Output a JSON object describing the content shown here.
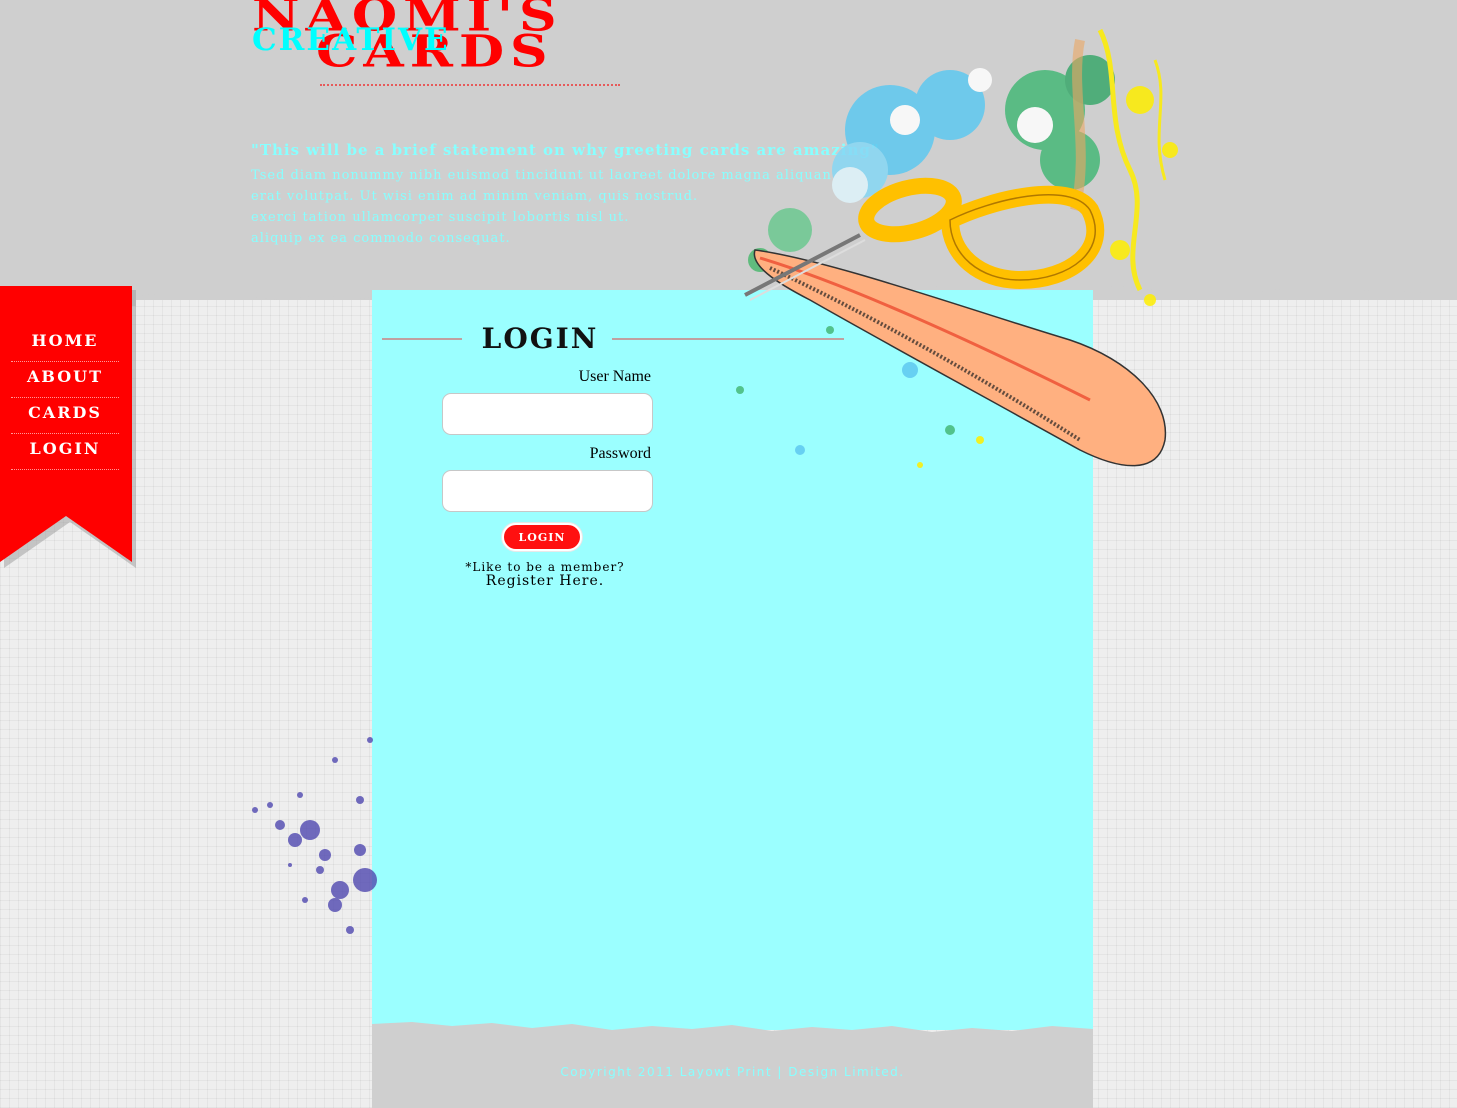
{
  "brand": {
    "line1": "NAOMI'S",
    "line2": "CARDS",
    "overlay": "CREATIVE",
    "primary_color": "#ff0000",
    "accent_color": "#00ffff"
  },
  "header": {
    "statement": "\"This will be a brief statement on why greeting cards are amazing\"",
    "lorem_lines": [
      "Tsed diam nonummy nibh euismod tincidunt ut laoreet dolore magna aliquan",
      "erat volutpat. Ut wisi enim ad minim veniam, quis nostrud.",
      "exerci tation ullamcorper suscipit lobortis nisl ut.",
      "aliquip ex ea commodo consequat."
    ],
    "illustration_icon": "scissors-icon"
  },
  "nav": {
    "items": [
      {
        "label": "HOME"
      },
      {
        "label": "ABOUT"
      },
      {
        "label": "CARDS"
      },
      {
        "label": "LOGIN"
      }
    ]
  },
  "login": {
    "heading": "LOGIN",
    "username_label": "User Name",
    "username_value": "",
    "password_label": "Password",
    "password_value": "",
    "submit_label": "LOGIN",
    "member_note": "*Like to be a member?",
    "register_label": "Register Here."
  },
  "footer": {
    "copyright": "Copyright 2011 Layowt Print | Design Limited."
  },
  "colors": {
    "content_bg": "#9bffff",
    "header_bg": "#cfcfcf",
    "ribbon": "#ff0000"
  }
}
